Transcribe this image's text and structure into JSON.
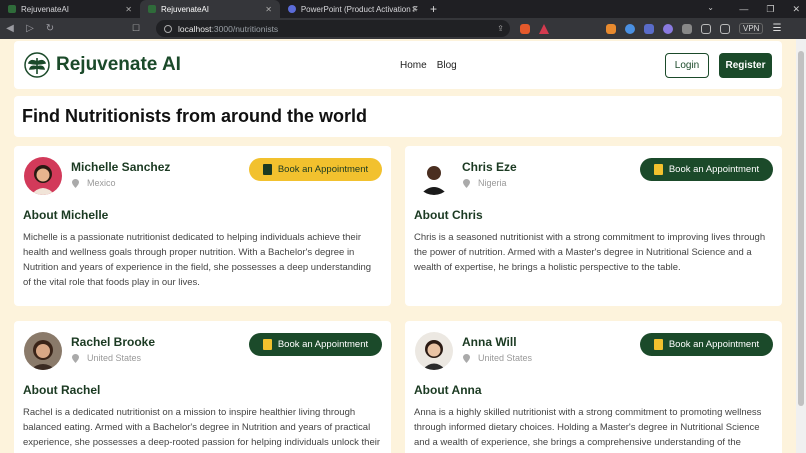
{
  "browser": {
    "tabs": [
      {
        "label": "RejuvenateAI",
        "active": false
      },
      {
        "label": "RejuvenateAI",
        "active": true
      },
      {
        "label": "PowerPoint (Product Activation Failed)",
        "active": false
      }
    ],
    "url_host": "localhost",
    "url_path": ":3000/nutritionists",
    "vpn_label": "VPN"
  },
  "header": {
    "logo_text": "Rejuvenate AI",
    "nav": [
      {
        "label": "Home"
      },
      {
        "label": "Blog"
      }
    ],
    "login_label": "Login",
    "register_label": "Register"
  },
  "page_title": "Find Nutritionists from around the world",
  "colors": {
    "brand": "#1b4a2a",
    "accent": "#f2c12e",
    "background": "#fdf3dc"
  },
  "nutritionists": [
    {
      "name": "Michelle Sanchez",
      "location": "Mexico",
      "button": "Book an Appointment",
      "button_style": "yellow",
      "about": "About Michelle",
      "bio": "Michelle is a passionate nutritionist dedicated to helping individuals achieve their health and wellness goals through proper nutrition. With a Bachelor's degree in Nutrition and years of experience in the field, she possesses a deep understanding of the vital role that foods play in our lives."
    },
    {
      "name": "Chris Eze",
      "location": "Nigeria",
      "button": "Book an Appointment",
      "button_style": "green",
      "about": "About Chris",
      "bio": "Chris is a seasoned nutritionist with a strong commitment to improving lives through the power of nutrition. Armed with a Master's degree in Nutritional Science and a wealth of expertise, he brings a holistic perspective to the table."
    },
    {
      "name": "Rachel Brooke",
      "location": "United States",
      "button": "Book an Appointment",
      "button_style": "green",
      "about": "About Rachel",
      "bio": "Rachel is a dedicated nutritionist on a mission to inspire healthier living through balanced eating. Armed with a Bachelor's degree in Nutrition and years of practical experience, she possesses a deep-rooted passion for helping individuals unlock their full wellness potential."
    },
    {
      "name": "Anna Will",
      "location": "United States",
      "button": "Book an Appointment",
      "button_style": "green",
      "about": "About Anna",
      "bio": "Anna is a highly skilled nutritionist with a strong commitment to promoting wellness through informed dietary choices. Holding a Master's degree in Nutritional Science and a wealth of experience, she brings a comprehensive understanding of the intricate relationship between nutrition and health."
    }
  ]
}
